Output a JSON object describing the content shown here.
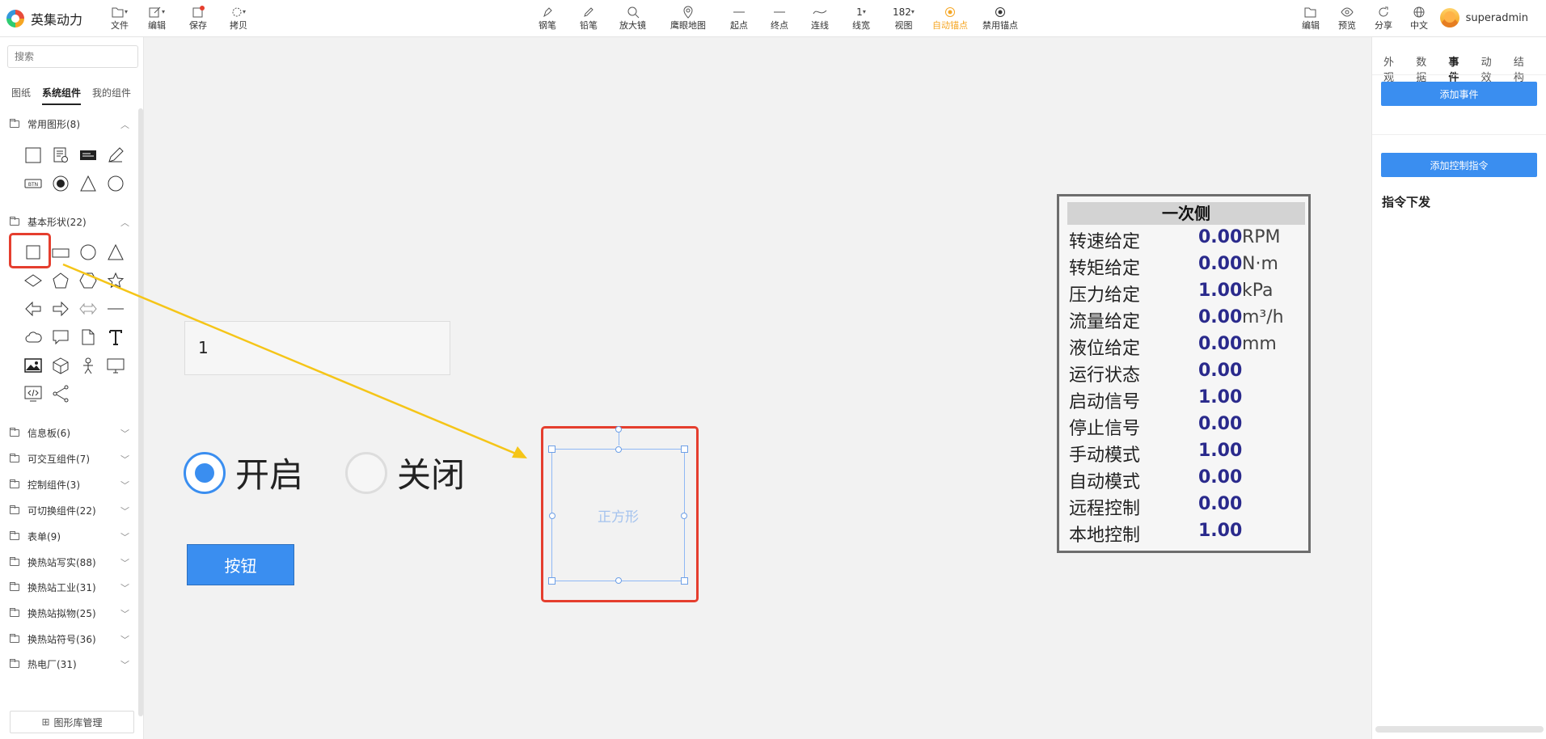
{
  "app": {
    "name": "英集动力"
  },
  "toolbar_left": [
    {
      "label": "文件",
      "icon": "file-icon"
    },
    {
      "label": "编辑",
      "icon": "edit-icon"
    },
    {
      "label": "保存",
      "icon": "save-icon"
    },
    {
      "label": "拷贝",
      "icon": "copy-icon"
    }
  ],
  "toolbar_center": [
    {
      "label": "钢笔",
      "icon": "pen-icon"
    },
    {
      "label": "铅笔",
      "icon": "pencil-icon"
    },
    {
      "label": "放大镜",
      "icon": "magnifier-icon"
    },
    {
      "label": "鹰眼地图",
      "icon": "map-pin-icon"
    },
    {
      "label": "起点",
      "icon": "start-line-icon"
    },
    {
      "label": "终点",
      "icon": "end-line-icon"
    },
    {
      "label": "连线",
      "icon": "curve-icon"
    },
    {
      "label": "线宽",
      "icon": "line-width-icon",
      "value": "1"
    },
    {
      "label": "视图",
      "icon": "zoom-icon",
      "value": "182"
    },
    {
      "label": "自动锚点",
      "icon": "auto-anchor-icon"
    },
    {
      "label": "禁用锚点",
      "icon": "disable-anchor-icon"
    }
  ],
  "toolbar_right": [
    {
      "label": "编辑",
      "icon": "edit-mode-icon"
    },
    {
      "label": "预览",
      "icon": "eye-icon"
    },
    {
      "label": "分享",
      "icon": "share-icon"
    },
    {
      "label": "中文",
      "icon": "globe-icon"
    }
  ],
  "user": {
    "name": "superadmin"
  },
  "left_panel": {
    "search_placeholder": "搜索",
    "tabs": [
      "图纸",
      "系统组件",
      "我的组件"
    ],
    "groups_expanded": [
      {
        "label": "常用图形(8)"
      },
      {
        "label": "基本形状(22)"
      }
    ],
    "groups_collapsed": [
      {
        "label": "信息板(6)"
      },
      {
        "label": "可交互组件(7)"
      },
      {
        "label": "控制组件(3)"
      },
      {
        "label": "可切换组件(22)"
      },
      {
        "label": "表单(9)"
      },
      {
        "label": "换热站写实(88)"
      },
      {
        "label": "换热站工业(31)"
      },
      {
        "label": "换热站拟物(25)"
      },
      {
        "label": "换热站符号(36)"
      },
      {
        "label": "热电厂(31)"
      }
    ],
    "library_button": "图形库管理",
    "btn_shape_text": "BTN"
  },
  "canvas": {
    "input_value": "1",
    "radio_on": "开启",
    "radio_off": "关闭",
    "button_label": "按钮",
    "square_label": "正方形",
    "table_title": "一次侧",
    "table_rows": [
      {
        "k": "转速给定",
        "v": "0.00",
        "u": "RPM"
      },
      {
        "k": "转矩给定",
        "v": "0.00",
        "u": "N·m"
      },
      {
        "k": "压力给定",
        "v": "1.00",
        "u": "kPa"
      },
      {
        "k": "流量给定",
        "v": "0.00",
        "u": "m³/h"
      },
      {
        "k": "液位给定",
        "v": "0.00",
        "u": "mm"
      },
      {
        "k": "运行状态",
        "v": "0.00",
        "u": ""
      },
      {
        "k": "启动信号",
        "v": "1.00",
        "u": ""
      },
      {
        "k": "停止信号",
        "v": "0.00",
        "u": ""
      },
      {
        "k": "手动模式",
        "v": "1.00",
        "u": ""
      },
      {
        "k": "自动模式",
        "v": "0.00",
        "u": ""
      },
      {
        "k": "远程控制",
        "v": "0.00",
        "u": ""
      },
      {
        "k": "本地控制",
        "v": "1.00",
        "u": ""
      }
    ]
  },
  "right_panel": {
    "tabs": [
      "外观",
      "数据",
      "事件",
      "动效",
      "结构"
    ],
    "active_tab": "事件",
    "add_event": "添加事件",
    "add_control": "添加控制指令",
    "section_title": "指令下发"
  },
  "colors": {
    "accent": "#3a8ef0",
    "highlight": "#e53e2e",
    "arrow": "#f5c518",
    "active_tool": "#f5a623"
  }
}
